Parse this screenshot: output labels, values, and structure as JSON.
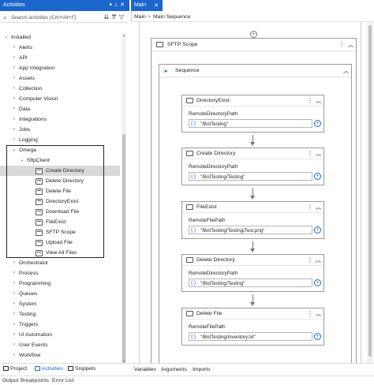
{
  "activities_panel": {
    "title": "Activities",
    "search_placeholder": "Search activities (Ctrl+Alt+F)",
    "tree": [
      {
        "label": "Installed",
        "level": 0,
        "expanded": true
      },
      {
        "label": "Alerts",
        "level": 1
      },
      {
        "label": "API",
        "level": 1
      },
      {
        "label": "App Integration",
        "level": 1
      },
      {
        "label": "Assets",
        "level": 1
      },
      {
        "label": "Collection",
        "level": 1
      },
      {
        "label": "Computer Vision",
        "level": 1
      },
      {
        "label": "Data",
        "level": 1
      },
      {
        "label": "Integrations",
        "level": 1
      },
      {
        "label": "Jobs",
        "level": 1
      },
      {
        "label": "Logging",
        "level": 1
      },
      {
        "label": "Omega",
        "level": 1,
        "expanded": true
      },
      {
        "label": "SftpClient",
        "level": 2,
        "expanded": true
      },
      {
        "label": "Create Directory",
        "level": 3,
        "leaf": true,
        "selected": true
      },
      {
        "label": "Delete Directory",
        "level": 3,
        "leaf": true
      },
      {
        "label": "Delete File",
        "level": 3,
        "leaf": true
      },
      {
        "label": "DirectoryExist",
        "level": 3,
        "leaf": true
      },
      {
        "label": "Download File",
        "level": 3,
        "leaf": true
      },
      {
        "label": "FileExist",
        "level": 3,
        "leaf": true
      },
      {
        "label": "SFTP Scope",
        "level": 3,
        "leaf": true
      },
      {
        "label": "Upload File",
        "level": 3,
        "leaf": true
      },
      {
        "label": "View All Files",
        "level": 3,
        "leaf": true
      },
      {
        "label": "Orchestrator",
        "level": 1
      },
      {
        "label": "Process",
        "level": 1
      },
      {
        "label": "Programming",
        "level": 1
      },
      {
        "label": "Queues",
        "level": 1
      },
      {
        "label": "System",
        "level": 1
      },
      {
        "label": "Testing",
        "level": 1
      },
      {
        "label": "Triggers",
        "level": 1
      },
      {
        "label": "UI Automation",
        "level": 1
      },
      {
        "label": "User Events",
        "level": 1
      },
      {
        "label": "Workflow",
        "level": 1
      }
    ],
    "bottom_tabs": [
      "Project",
      "Activities",
      "Snippets"
    ]
  },
  "status_tabs": [
    "Output",
    "Breakpoints",
    "Error List"
  ],
  "designer": {
    "doc_tab": "Main",
    "breadcrumb": [
      "Main",
      "Main Sequence"
    ],
    "scope_title": "SFTP Scope",
    "sequence_title": "Sequence",
    "activities": [
      {
        "title": "DirectoryExist",
        "prop_label": "RemoteDirectoryPath",
        "value": "\"/BotTesting\""
      },
      {
        "title": "Create Directory",
        "prop_label": "RemoteDirectoryPath",
        "value": "\"/BotTesting/Testing\""
      },
      {
        "title": "FileExist",
        "prop_label": "RemoteFilePath",
        "value": "\"/BotTesting/Testing/Test.png\""
      },
      {
        "title": "Delete Directory",
        "prop_label": "RemoteDirectoryPath",
        "value": "\"/BotTesting/Testing\""
      },
      {
        "title": "Delete File",
        "prop_label": "RemoteFilePath",
        "value": "\"/BotTesting/Inventory.txt\""
      }
    ],
    "bottom_tabs": [
      "Variables",
      "Arguments",
      "Imports"
    ]
  },
  "icons": {
    "search": "search-icon",
    "filter": "filter-icon",
    "collapse": "collapse-icon",
    "pin": "pin-icon",
    "more": "more-icon",
    "plus": "plus-icon"
  },
  "colors": {
    "accent": "#1a66cc",
    "selected_row": "#d9d9d9"
  }
}
